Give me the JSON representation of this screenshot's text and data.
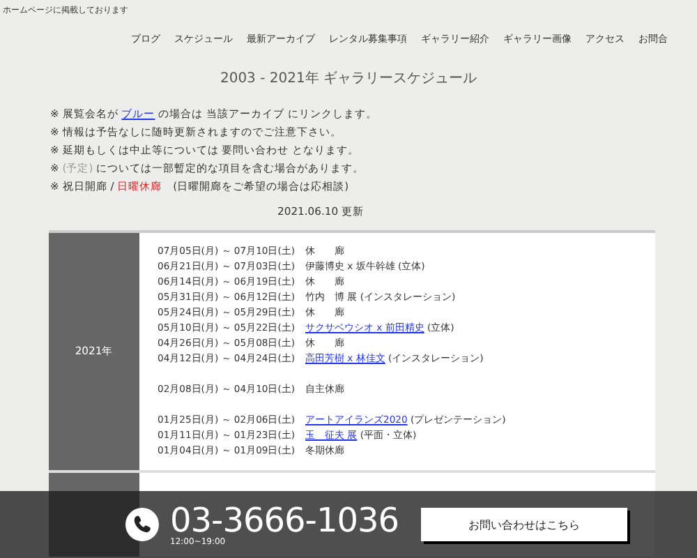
{
  "top_notice": "ホームページに掲載しております",
  "nav": [
    "ブログ",
    "スケジュール",
    "最新アーカイブ",
    "レンタル募集事項",
    "ギャラリー紹介",
    "ギャラリー画像",
    "アクセス",
    "お問合"
  ],
  "title": "2003 - 2021年 ギャラリースケジュール",
  "notes": [
    [
      {
        "kind": "text",
        "text": "※ 展覧会名が "
      },
      {
        "kind": "link",
        "text": "ブルー"
      },
      {
        "kind": "text",
        "text": " の場合は 当該アーカイブ にリンクします。"
      }
    ],
    [
      {
        "kind": "text",
        "text": "※ 情報は予告なしに随時更新されますのでご注意下さい。"
      }
    ],
    [
      {
        "kind": "text",
        "text": "※ 延期もしくは中止等については 要問い合わせ となります。"
      }
    ],
    [
      {
        "kind": "text",
        "text": "※ "
      },
      {
        "kind": "muted",
        "text": "(予定)"
      },
      {
        "kind": "text",
        "text": " については一部暫定的な項目を含む場合があります。"
      }
    ],
    [
      {
        "kind": "text",
        "text": "※ 祝日開廊 / "
      },
      {
        "kind": "red",
        "text": "日曜休廊"
      },
      {
        "kind": "text",
        "text": "　(日曜開廊をご希望の場合は応相談)"
      }
    ]
  ],
  "updated": "2021.06.10 更新",
  "years": [
    {
      "year": "2021年",
      "rows": [
        {
          "date": "07月05日(月) ～ 07月10日(土)",
          "title": "休　　廊",
          "link": false,
          "gap_before": false
        },
        {
          "date": "06月21日(月) ～ 07月03日(土)",
          "title": "伊藤博史 x 坂牛幹雄 (立体)",
          "link": false,
          "gap_before": false
        },
        {
          "date": "06月14日(月) ～ 06月19日(土)",
          "title": "休　　廊",
          "link": false,
          "gap_before": false
        },
        {
          "date": "05月31日(月) ～ 06月12日(土)",
          "title": "竹内　博 展 (インスタレーション)",
          "link": false,
          "gap_before": false
        },
        {
          "date": "05月24日(月) ～ 05月29日(土)",
          "title": "休　　廊",
          "link": false,
          "gap_before": false
        },
        {
          "date": "05月10日(月) ～ 05月22日(土)",
          "title": "サクサベウシオ x 前田精史",
          "note": " (立体)",
          "link": true,
          "gap_before": false
        },
        {
          "date": "04月26日(月) ～ 05月08日(土)",
          "title": "休　　廊",
          "link": false,
          "gap_before": false
        },
        {
          "date": "04月12日(月) ～ 04月24日(土)",
          "title": "高田芳樹 x 林佳文",
          "note": " (インスタレーション)",
          "link": true,
          "gap_before": false
        },
        {
          "date": "02月08日(月) ～ 04月10日(土)",
          "title": "自主休廊",
          "link": false,
          "gap_before": true
        },
        {
          "date": "01月25日(月) ～ 02月06日(土)",
          "title": "アートアイランズ2020",
          "note": " (プレゼンテーション)",
          "link": true,
          "gap_before": true
        },
        {
          "date": "01月11日(月) ～ 01月23日(土)",
          "title": "玉　征夫 展",
          "note": " (平面・立体)",
          "link": true,
          "gap_before": false
        },
        {
          "date": "01月04日(月) ～ 01月09日(土)",
          "title": "冬期休廊",
          "link": false,
          "gap_before": false
        }
      ]
    }
  ],
  "contact": {
    "phone": "03-3666-1036",
    "hours": "12:00~19:00",
    "button": "お問い合わせはこちら"
  }
}
